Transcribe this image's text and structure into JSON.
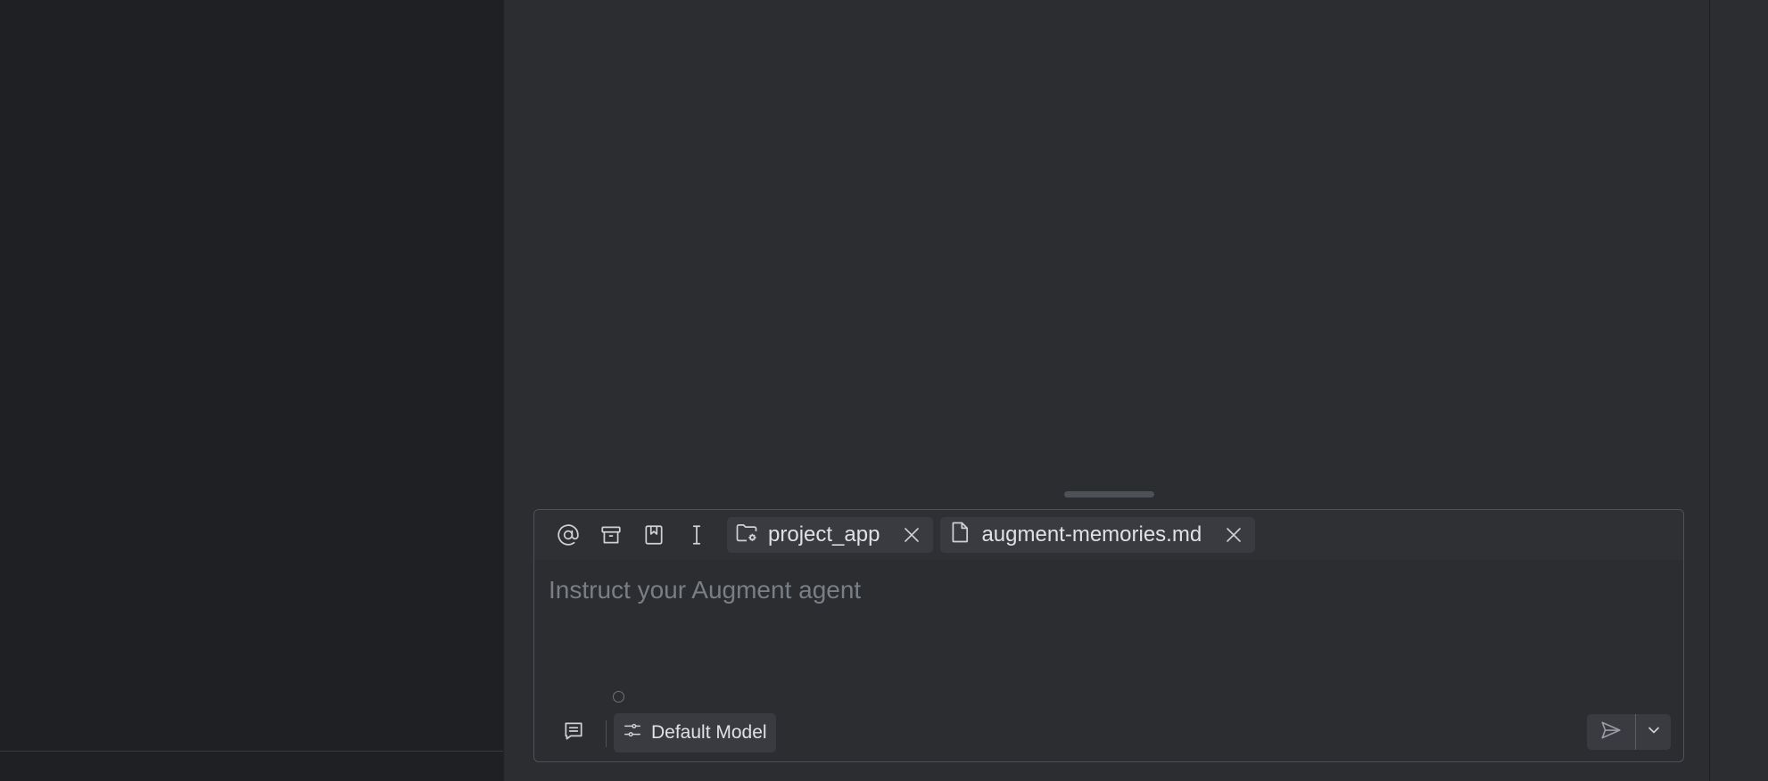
{
  "toolbar": {
    "icons": [
      "at-icon",
      "archive-icon",
      "bookmark-icon",
      "text-cursor-icon"
    ],
    "chips": [
      {
        "label": "project_app",
        "icon": "folder-settings-icon"
      },
      {
        "label": "augment-memories.md",
        "icon": "file-icon"
      }
    ]
  },
  "prompt": {
    "placeholder": "Instruct your Augment agent",
    "value": ""
  },
  "footer": {
    "model_label": "Default Model"
  },
  "colors": {
    "background": "#1f2023",
    "panel": "#2b2d30",
    "chip": "#393b40",
    "border": "#4e5157",
    "placeholder": "#7a7e85"
  }
}
